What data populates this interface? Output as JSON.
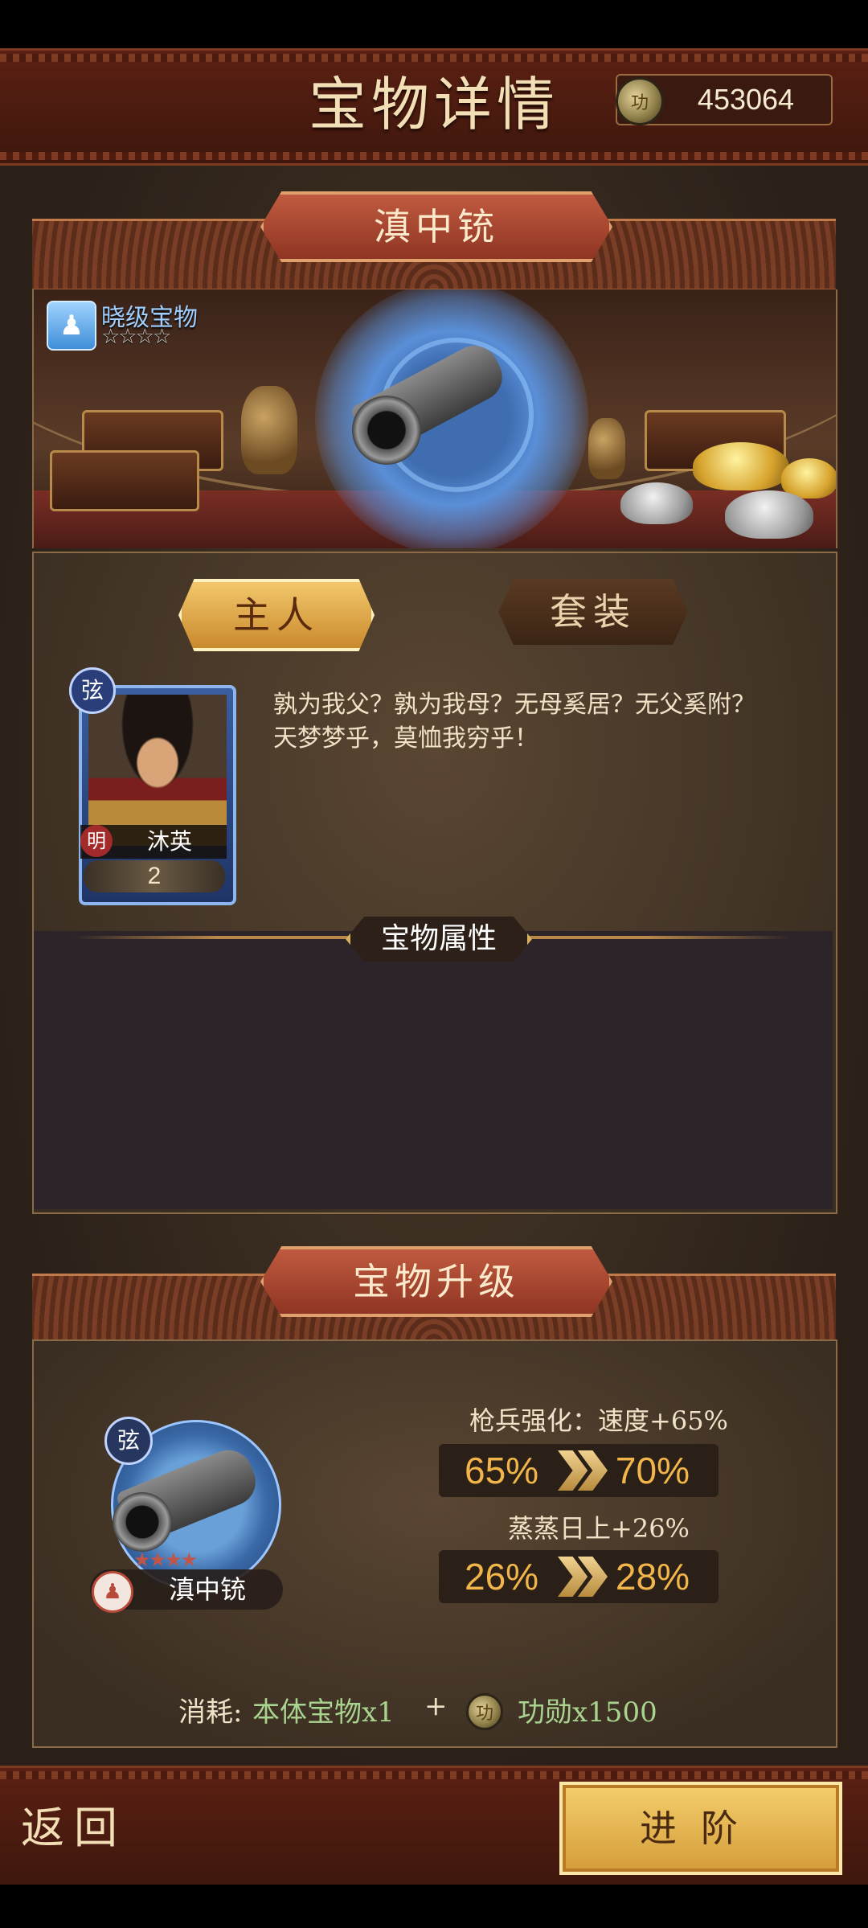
{
  "header": {
    "title": "宝物详情",
    "currency_value": "453064"
  },
  "treasure": {
    "name": "滇中铳",
    "rank_label": "晓级宝物",
    "rank_stars": "☆☆☆☆"
  },
  "tabs": {
    "owner": "主人",
    "set": "套装"
  },
  "owner": {
    "badge": "弦",
    "faction": "明",
    "name": "沐英",
    "level": "2",
    "lore": "孰为我父？孰为我母？无母奚居？无父奚附？天梦梦乎，莫恤我穷乎！"
  },
  "attributes": {
    "title": "宝物属性"
  },
  "upgrade": {
    "title": "宝物升级",
    "item_badge": "弦",
    "item_name": "滇中铳",
    "item_stars": "★★★★",
    "stats": [
      {
        "label": "枪兵强化：速度+65%",
        "from": "65%",
        "to": "70%"
      },
      {
        "label": "蒸蒸日上+26%",
        "from": "26%",
        "to": "28%"
      }
    ],
    "cost_label": "消耗:",
    "cost_item": "本体宝物x1",
    "cost_plus": "+",
    "cost_merit": "功勋x1500"
  },
  "footer": {
    "back": "返回",
    "advance": "进阶"
  },
  "colors": {
    "accent_gold": "#f1b54a",
    "cost_green": "#a9d48f"
  }
}
